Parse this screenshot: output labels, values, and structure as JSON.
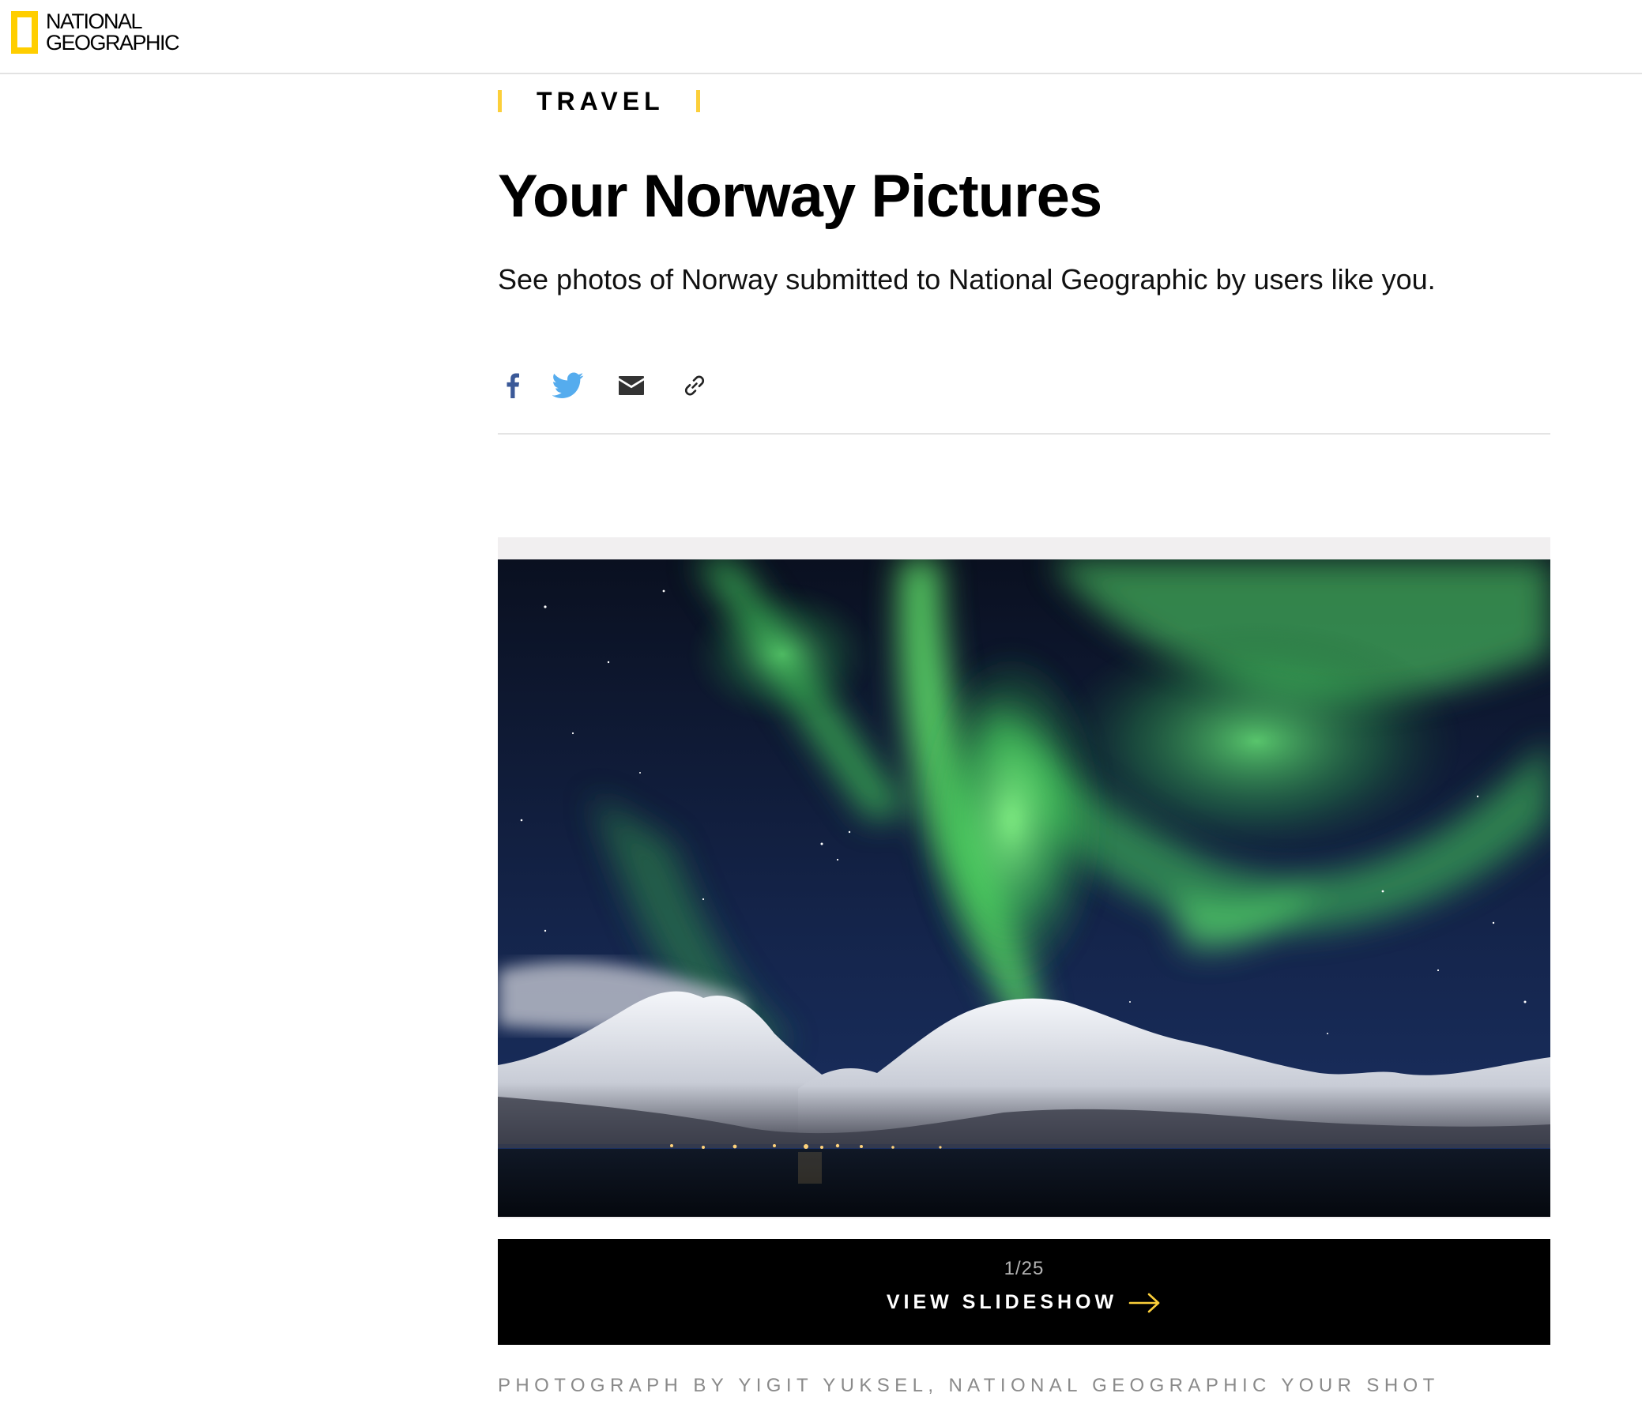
{
  "header": {
    "logo_line1": "NATIONAL",
    "logo_line2": "GEOGRAPHIC",
    "logo_color": "#ffce00"
  },
  "article": {
    "section": "TRAVEL",
    "title": "Your Norway Pictures",
    "dek": "See photos of Norway submitted to National Geographic by users like you."
  },
  "share": {
    "icons": [
      "facebook-icon",
      "twitter-icon",
      "email-icon",
      "link-icon"
    ],
    "facebook_color": "#3b5998",
    "twitter_color": "#55acee"
  },
  "slideshow": {
    "count": "1/25",
    "cta": "VIEW SLIDESHOW",
    "arrow_color": "#fccf3a",
    "credit": "PHOTOGRAPH BY YIGIT YUKSEL, NATIONAL GEOGRAPHIC YOUR SHOT"
  },
  "colors": {
    "accent": "#fccf3a",
    "aurora": "#5fe36a"
  }
}
